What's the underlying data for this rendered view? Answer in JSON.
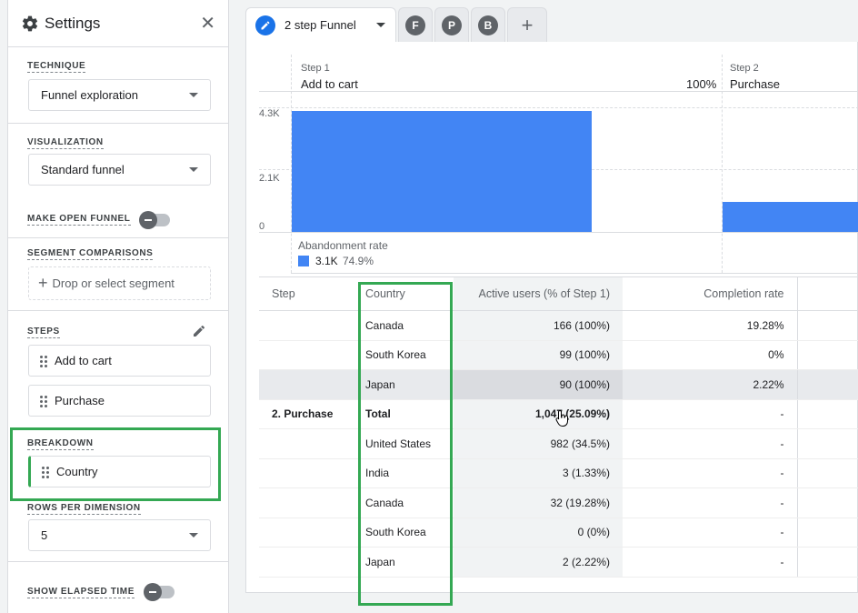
{
  "settings": {
    "title": "Settings",
    "technique": {
      "label": "TECHNIQUE",
      "value": "Funnel exploration"
    },
    "visualization": {
      "label": "VISUALIZATION",
      "value": "Standard funnel"
    },
    "open_funnel": {
      "label": "MAKE OPEN FUNNEL"
    },
    "segments": {
      "label": "SEGMENT COMPARISONS",
      "placeholder": "Drop or select segment"
    },
    "steps": {
      "label": "STEPS",
      "items": [
        "Add to cart",
        "Purchase"
      ]
    },
    "breakdown": {
      "label": "BREAKDOWN",
      "value": "Country"
    },
    "rows": {
      "label": "ROWS PER DIMENSION",
      "value": "5"
    },
    "elapsed": {
      "label": "SHOW ELAPSED TIME"
    }
  },
  "tabs": {
    "active": "2 step Funnel",
    "others": [
      {
        "letter": "F"
      },
      {
        "letter": "P"
      },
      {
        "letter": "B"
      }
    ],
    "add": "+"
  },
  "chart": {
    "yticks": [
      "4.3K",
      "2.1K",
      "0"
    ],
    "steps": [
      {
        "num": "Step 1",
        "name": "Add to cart",
        "pct": "100%"
      },
      {
        "num": "Step 2",
        "name": "Purchase"
      }
    ],
    "abandonment": {
      "label": "Abandonment rate",
      "value": "3.1K",
      "pct": "74.9%"
    }
  },
  "chart_data": {
    "type": "bar",
    "categories": [
      "Add to cart",
      "Purchase"
    ],
    "values": [
      4180,
      1047
    ],
    "ylim": [
      0,
      4300
    ]
  },
  "table": {
    "headers": [
      "Step",
      "Country",
      "Active users (% of Step 1)",
      "Completion rate"
    ],
    "rows": [
      {
        "step": "",
        "country": "Canada",
        "users": "166 (100%)",
        "rate": "19.28%"
      },
      {
        "step": "",
        "country": "South Korea",
        "users": "99 (100%)",
        "rate": "0%"
      },
      {
        "step": "",
        "country": "Japan",
        "users": "90 (100%)",
        "rate": "2.22%"
      },
      {
        "step": "2. Purchase",
        "country": "Total",
        "users": "1,047 (25.09%)",
        "rate": "-"
      },
      {
        "step": "",
        "country": "United States",
        "users": "982 (34.5%)",
        "rate": "-"
      },
      {
        "step": "",
        "country": "India",
        "users": "3 (1.33%)",
        "rate": "-"
      },
      {
        "step": "",
        "country": "Canada",
        "users": "32 (19.28%)",
        "rate": "-"
      },
      {
        "step": "",
        "country": "South Korea",
        "users": "0 (0%)",
        "rate": "-"
      },
      {
        "step": "",
        "country": "Japan",
        "users": "2 (2.22%)",
        "rate": "-"
      }
    ]
  },
  "colors": {
    "accent": "#1a73e8",
    "bar": "#4285f4",
    "highlight": "#34a853"
  }
}
